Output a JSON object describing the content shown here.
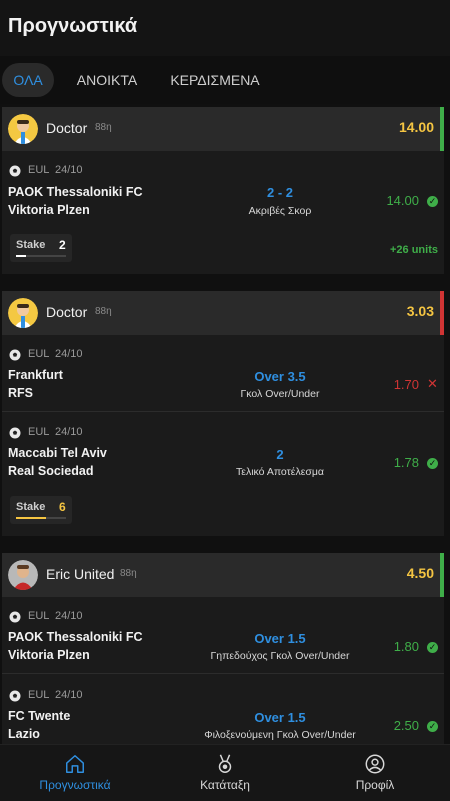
{
  "header": {
    "title": "Προγνωστικά"
  },
  "filters": [
    {
      "label": "ΟΛΑ",
      "active": true
    },
    {
      "label": "ΑΝΟΙΚΤΑ",
      "active": false
    },
    {
      "label": "ΚΕΡΔΙΣΜΕΝΑ",
      "active": false
    }
  ],
  "cards": [
    {
      "tipster": "Doctor",
      "age": "88η",
      "total_odds": "14.00",
      "status": "won",
      "matches": [
        {
          "league": "EUL",
          "date": "24/10",
          "home": "PAOK Thessaloniki FC",
          "away": "Viktoria Plzen",
          "pick": "2 - 2",
          "market": "Ακριβές Σκορ",
          "odds": "14.00",
          "result": "win"
        }
      ],
      "stake_label": "Stake",
      "stake": "2",
      "stake_fraction": 0.2,
      "profit": "+26 units"
    },
    {
      "tipster": "Doctor",
      "age": "88η",
      "total_odds": "3.03",
      "status": "lost",
      "matches": [
        {
          "league": "EUL",
          "date": "24/10",
          "home": "Frankfurt",
          "away": "RFS",
          "pick": "Over 3.5",
          "market": "Γκολ Over/Under",
          "odds": "1.70",
          "result": "lose"
        },
        {
          "league": "EUL",
          "date": "24/10",
          "home": "Maccabi Tel Aviv",
          "away": "Real Sociedad",
          "pick": "2",
          "market": "Τελικό Αποτέλεσμα",
          "odds": "1.78",
          "result": "win"
        }
      ],
      "stake_label": "Stake",
      "stake": "6",
      "stake_fraction": 0.6
    },
    {
      "tipster": "Eric United",
      "age": "88η",
      "total_odds": "4.50",
      "status": "won",
      "matches": [
        {
          "league": "EUL",
          "date": "24/10",
          "home": "PAOK Thessaloniki FC",
          "away": "Viktoria Plzen",
          "pick": "Over 1.5",
          "market": "Γηπεδούχος Γκολ Over/Under",
          "odds": "1.80",
          "result": "win"
        },
        {
          "league": "EUL",
          "date": "24/10",
          "home": "FC Twente",
          "away": "Lazio",
          "pick": "Over 1.5",
          "market": "Φιλοξενούμενη Γκολ Over/Under",
          "odds": "2.50",
          "result": "win"
        }
      ]
    }
  ],
  "nav": [
    {
      "label": "Προγνωστικά",
      "icon": "home-icon",
      "active": true
    },
    {
      "label": "Κατάταξη",
      "icon": "medal-icon",
      "active": false
    },
    {
      "label": "Προφίλ",
      "icon": "user-icon",
      "active": false
    }
  ],
  "colors": {
    "accent_blue": "#2f8fe0",
    "odds_gold": "#f5c542",
    "win_green": "#3fae49",
    "lose_red": "#d03434",
    "stake_gold": "#f5c542",
    "stake_white": "#ffffff"
  }
}
